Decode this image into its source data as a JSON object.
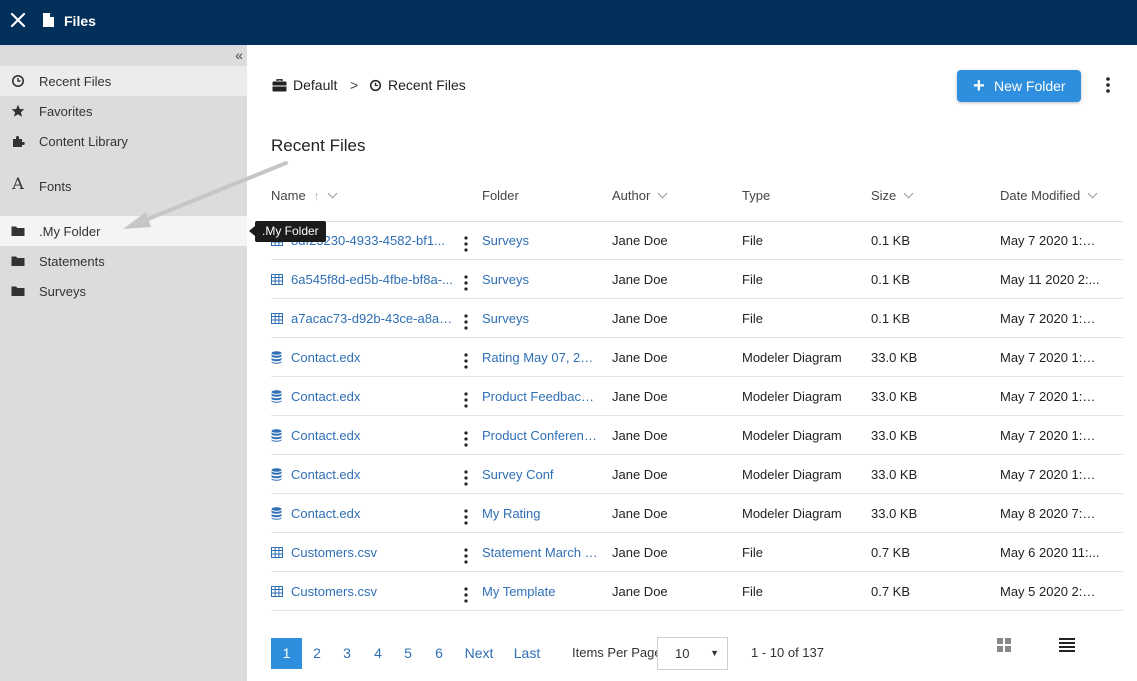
{
  "app": {
    "title": "Files"
  },
  "sidebar": {
    "collapse_label": "«",
    "items": [
      {
        "label": "Recent Files",
        "icon": "clock-icon"
      },
      {
        "label": "Favorites",
        "icon": "star-icon"
      },
      {
        "label": "Content Library",
        "icon": "puzzle-icon"
      },
      {
        "label": "Fonts",
        "icon": "font-icon"
      },
      {
        "label": ".My Folder",
        "icon": "folder-icon"
      },
      {
        "label": "Statements",
        "icon": "folder-icon"
      },
      {
        "label": "Surveys",
        "icon": "folder-icon"
      }
    ]
  },
  "tooltip": {
    "text": ".My Folder"
  },
  "breadcrumb": {
    "root": "Default",
    "separator": ">",
    "current": "Recent Files"
  },
  "toolbar": {
    "new_folder_label": "New Folder"
  },
  "main": {
    "title": "Recent Files"
  },
  "table": {
    "columns": [
      "Name",
      "Folder",
      "Author",
      "Type",
      "Size",
      "Date Modified"
    ],
    "rows": [
      {
        "name": "8df23230-4933-4582-bf1...",
        "folder": "Surveys",
        "author": "Jane Doe",
        "type": "File",
        "size": "0.1 KB",
        "date": "May 7 2020 1:2...",
        "icon": "table-icon"
      },
      {
        "name": "6a545f8d-ed5b-4fbe-bf8a-...",
        "folder": "Surveys",
        "author": "Jane Doe",
        "type": "File",
        "size": "0.1 KB",
        "date": "May 11 2020 2:...",
        "icon": "table-icon"
      },
      {
        "name": "a7acac73-d92b-43ce-a8a5-...",
        "folder": "Surveys",
        "author": "Jane Doe",
        "type": "File",
        "size": "0.1 KB",
        "date": "May 7 2020 1:5...",
        "icon": "table-icon"
      },
      {
        "name": "Contact.edx",
        "folder": "Rating May 07, 2020",
        "author": "Jane Doe",
        "type": "Modeler Diagram",
        "size": "33.0 KB",
        "date": "May 7 2020 1:1...",
        "icon": "database-icon"
      },
      {
        "name": "Contact.edx",
        "folder": "Product Feedback ...",
        "author": "Jane Doe",
        "type": "Modeler Diagram",
        "size": "33.0 KB",
        "date": "May 7 2020 1:1...",
        "icon": "database-icon"
      },
      {
        "name": "Contact.edx",
        "folder": "Product Conferenc...",
        "author": "Jane Doe",
        "type": "Modeler Diagram",
        "size": "33.0 KB",
        "date": "May 7 2020 1:1...",
        "icon": "database-icon"
      },
      {
        "name": "Contact.edx",
        "folder": "Survey Conf",
        "author": "Jane Doe",
        "type": "Modeler Diagram",
        "size": "33.0 KB",
        "date": "May 7 2020 1:1...",
        "icon": "database-icon"
      },
      {
        "name": "Contact.edx",
        "folder": "My Rating",
        "author": "Jane Doe",
        "type": "Modeler Diagram",
        "size": "33.0 KB",
        "date": "May 8 2020 7:4...",
        "icon": "database-icon"
      },
      {
        "name": "Customers.csv",
        "folder": "Statement March 2...",
        "author": "Jane Doe",
        "type": "File",
        "size": "0.7 KB",
        "date": "May 6 2020 11:...",
        "icon": "table-icon"
      },
      {
        "name": "Customers.csv",
        "folder": "My Template",
        "author": "Jane Doe",
        "type": "File",
        "size": "0.7 KB",
        "date": "May 5 2020 2:0...",
        "icon": "table-icon"
      }
    ]
  },
  "pagination": {
    "pages": [
      "1",
      "2",
      "3",
      "4",
      "5",
      "6"
    ],
    "current_page": "1",
    "next": "Next",
    "last": "Last",
    "items_per_page_label": "Items Per Page",
    "items_per_page_value": "10",
    "range": "1 - 10 of 137"
  },
  "colors": {
    "header": "#03305a",
    "accent": "#2d8fdd",
    "link": "#2f6fb6",
    "sidebar": "#dcdcdc"
  }
}
